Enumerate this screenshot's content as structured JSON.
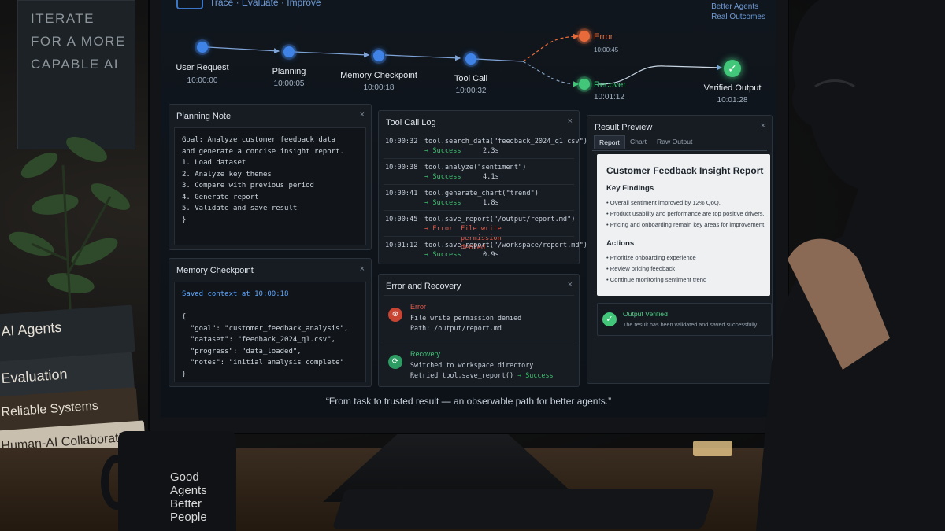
{
  "poster": {
    "lines": [
      "ITERATE",
      "FOR A MORE",
      "CAPABLE AI"
    ]
  },
  "books": [
    "AI Agents",
    "Evaluation",
    "Reliable Systems",
    "Human-AI Collaboration"
  ],
  "mug": {
    "lines": [
      "Good",
      "Agents",
      "Better",
      "People"
    ]
  },
  "header": {
    "subtitle": "Trace · Evaluate · Improve",
    "tagline": [
      "Better Agents",
      "Real Outcomes"
    ]
  },
  "flow": {
    "nodes": [
      {
        "label": "User Request",
        "time": "10:00:00"
      },
      {
        "label": "Planning",
        "time": "10:00:05"
      },
      {
        "label": "Memory Checkpoint",
        "time": "10:00:18"
      },
      {
        "label": "Tool Call",
        "time": "10:00:32"
      },
      {
        "label": "Error",
        "time": "10:00:45"
      },
      {
        "label": "Recover",
        "time": "10:01:12"
      },
      {
        "label": "Verified Output",
        "time": "10:01:28"
      }
    ],
    "colors": {
      "primary": "#3f83e6",
      "error": "#e86a3a",
      "success": "#42c77a"
    }
  },
  "planning": {
    "title": "Planning Note",
    "lines": [
      "Goal: Analyze customer feedback data",
      "and generate a concise insight report.",
      "",
      "1. Load dataset",
      "2. Analyze key themes",
      "3. Compare with previous period",
      "4. Generate report",
      "5. Validate and save result",
      "}"
    ]
  },
  "memory": {
    "title": "Memory Checkpoint",
    "saved": "Saved context at 10:00:18",
    "lines": [
      "{",
      "  \"goal\": \"customer_feedback_analysis\",",
      "  \"dataset\": \"feedback_2024_q1.csv\",",
      "  \"progress\": \"data_loaded\",",
      "  \"notes\": \"initial analysis complete\"",
      "}"
    ]
  },
  "toollog": {
    "title": "Tool Call Log",
    "rows": [
      {
        "time": "10:00:32",
        "call": "tool.search_data(\"feedback_2024_q1.csv\")",
        "status": "→ Success",
        "duration": "2.3s",
        "error": false
      },
      {
        "time": "10:00:38",
        "call": "tool.analyze(\"sentiment\")",
        "status": "→ Success",
        "duration": "4.1s",
        "error": false
      },
      {
        "time": "10:00:41",
        "call": "tool.generate_chart(\"trend\")",
        "status": "→ Success",
        "duration": "1.8s",
        "error": false
      },
      {
        "time": "10:00:45",
        "call": "tool.save_report(\"/output/report.md\")",
        "status": "→ Error",
        "duration": "File write permission denied",
        "error": true
      },
      {
        "time": "10:01:12",
        "call": "tool.save_report(\"/workspace/report.md\")",
        "status": "→ Success",
        "duration": "0.9s",
        "error": false
      }
    ]
  },
  "errrec": {
    "title": "Error and Recovery",
    "error_title": "Error",
    "error_lines": [
      "File write permission denied",
      "Path: /output/report.md"
    ],
    "recovery_title": "Recovery",
    "recovery_lines": [
      "Switched to workspace directory",
      "Retried tool.save_report()"
    ],
    "recovery_status": "→ Success"
  },
  "result": {
    "title": "Result Preview",
    "tabs": [
      "Report",
      "Chart",
      "Raw Output"
    ],
    "report_title": "Customer Feedback Insight Report",
    "findings_heading": "Key Findings",
    "findings": [
      "Overall sentiment improved by 12% QoQ.",
      "Product usability and performance are top positive drivers.",
      "Pricing and onboarding remain key areas for improvement."
    ],
    "actions_heading": "Actions",
    "actions": [
      "Prioritize onboarding experience",
      "Review pricing feedback",
      "Continue monitoring sentiment trend"
    ],
    "verified_title": "Output Verified",
    "verified_sub": "The result has been validated and saved successfully."
  },
  "quote": "“From task to trusted result — an observable path for better agents.”",
  "close_glyph": "×",
  "icons": {
    "check": "✓",
    "error": "⊗",
    "recover": "⟳"
  }
}
